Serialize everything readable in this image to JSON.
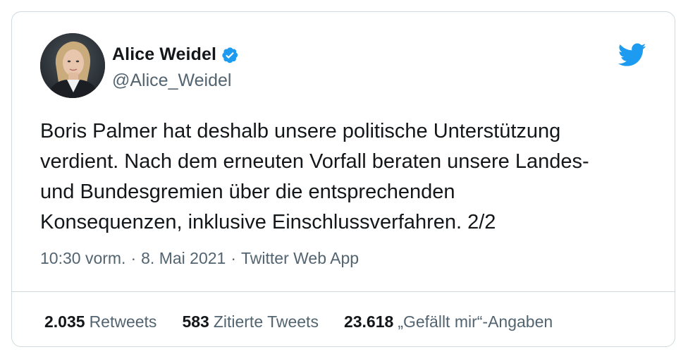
{
  "author": {
    "display_name": "Alice Weidel",
    "handle": "@Alice_Weidel",
    "verified_icon": "verified-badge-icon",
    "avatar": "profile-photo"
  },
  "brand": {
    "icon": "twitter-bird-icon",
    "color": "#1d9bf0"
  },
  "tweet": {
    "text": "Boris Palmer hat deshalb unsere politische Unterstützung\nverdient. Nach dem erneuten Vorfall beraten unsere Landes-\nund Bundesgremien über die entsprechenden\nKonsequenzen, inklusive Einschlussverfahren. 2/2"
  },
  "meta": {
    "time": "10:30 vorm.",
    "separator": "·",
    "date": "8. Mai 2021",
    "source": "Twitter Web App"
  },
  "stats": {
    "retweets_count": "2.035",
    "retweets_label": "Retweets",
    "quotes_count": "583",
    "quotes_label": "Zitierte Tweets",
    "likes_count": "23.618",
    "likes_label": "„Gefällt mir“-Angaben"
  },
  "colors": {
    "text": "#14171a",
    "secondary": "#536471",
    "border": "#cfd9de",
    "accent": "#1d9bf0"
  }
}
